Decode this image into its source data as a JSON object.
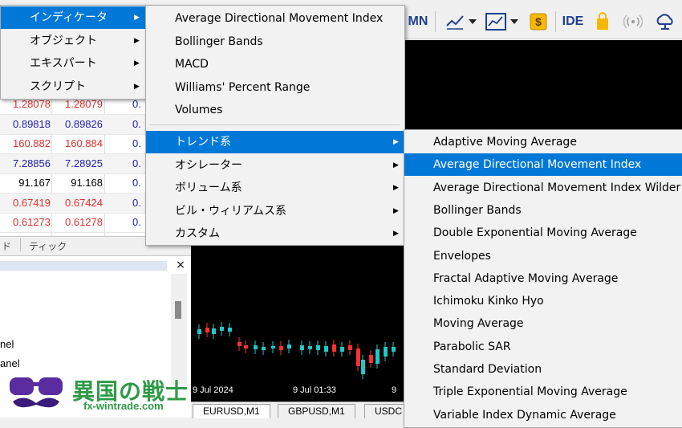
{
  "colors": {
    "highlight": "#0078d7",
    "bid_red": "#e03030",
    "bid_blue": "#1f1fb0",
    "bull_candle": "#20c8c8",
    "bear_candle": "#ff3030"
  },
  "toolbar": {
    "timeframe_mn": "MN",
    "ide_label": "IDE",
    "icons": [
      "line-chart-icon",
      "dropdown-icon",
      "chart-template-icon",
      "dropdown-icon",
      "dollar-icon",
      "ide-icon",
      "market-bag-icon",
      "signal-icon",
      "cloud-icon"
    ]
  },
  "main_menu": {
    "items": [
      {
        "label": "インディケータ",
        "highlighted": true
      },
      {
        "label": "オブジェクト"
      },
      {
        "label": "エキスパート"
      },
      {
        "label": "スクリプト"
      }
    ]
  },
  "indicators_menu": {
    "top_items": [
      "Average Directional Movement Index",
      "Bollinger Bands",
      "MACD",
      "Williams' Percent Range",
      "Volumes"
    ],
    "sub_items": [
      {
        "label": "トレンド系",
        "highlighted": true
      },
      {
        "label": "オシレーター"
      },
      {
        "label": "ボリューム系"
      },
      {
        "label": "ビル・ウィリアムス系"
      },
      {
        "label": "カスタム"
      }
    ]
  },
  "trend_menu": {
    "items": [
      {
        "label": "Adaptive Moving Average"
      },
      {
        "label": "Average Directional Movement Index",
        "highlighted": true
      },
      {
        "label": "Average Directional Movement Index Wilder"
      },
      {
        "label": "Bollinger Bands"
      },
      {
        "label": "Double Exponential Moving Average"
      },
      {
        "label": "Envelopes"
      },
      {
        "label": "Fractal Adaptive Moving Average"
      },
      {
        "label": "Ichimoku Kinko Hyo"
      },
      {
        "label": "Moving Average"
      },
      {
        "label": "Parabolic SAR"
      },
      {
        "label": "Standard Deviation"
      },
      {
        "label": "Triple Exponential Moving Average"
      },
      {
        "label": "Variable Index Dynamic Average"
      }
    ]
  },
  "market_watch": {
    "rows": [
      {
        "bid": "1.28078",
        "ask": "1.28079",
        "spread": "0.",
        "color": "red"
      },
      {
        "bid": "0.89818",
        "ask": "0.89826",
        "spread": "0.",
        "color": "blue"
      },
      {
        "bid": "160.882",
        "ask": "160.884",
        "spread": "0.",
        "color": "red"
      },
      {
        "bid": "7.28856",
        "ask": "7.28925",
        "spread": "0.",
        "color": "blue"
      },
      {
        "bid": "91.167",
        "ask": "91.168",
        "spread": "0.",
        "color": "black"
      },
      {
        "bid": "0.67419",
        "ask": "0.67424",
        "spread": "0.",
        "color": "red"
      },
      {
        "bid": "0.61273",
        "ask": "0.61278",
        "spread": "0.",
        "color": "red"
      }
    ],
    "tabs": [
      "ド",
      "ティック"
    ]
  },
  "navigator": {
    "items": [
      "nel",
      "anel"
    ],
    "close_label": "×"
  },
  "chart": {
    "time_labels": [
      "9 Jul 2024",
      "9 Jul 01:33",
      "9"
    ],
    "tabs": [
      {
        "label": "EURUSD,M1",
        "active": true
      },
      {
        "label": "GBPUSD,M1"
      },
      {
        "label": "USDC"
      }
    ]
  },
  "watermark": {
    "title": "異国の戦士",
    "url": "fx-wintrade.com"
  }
}
